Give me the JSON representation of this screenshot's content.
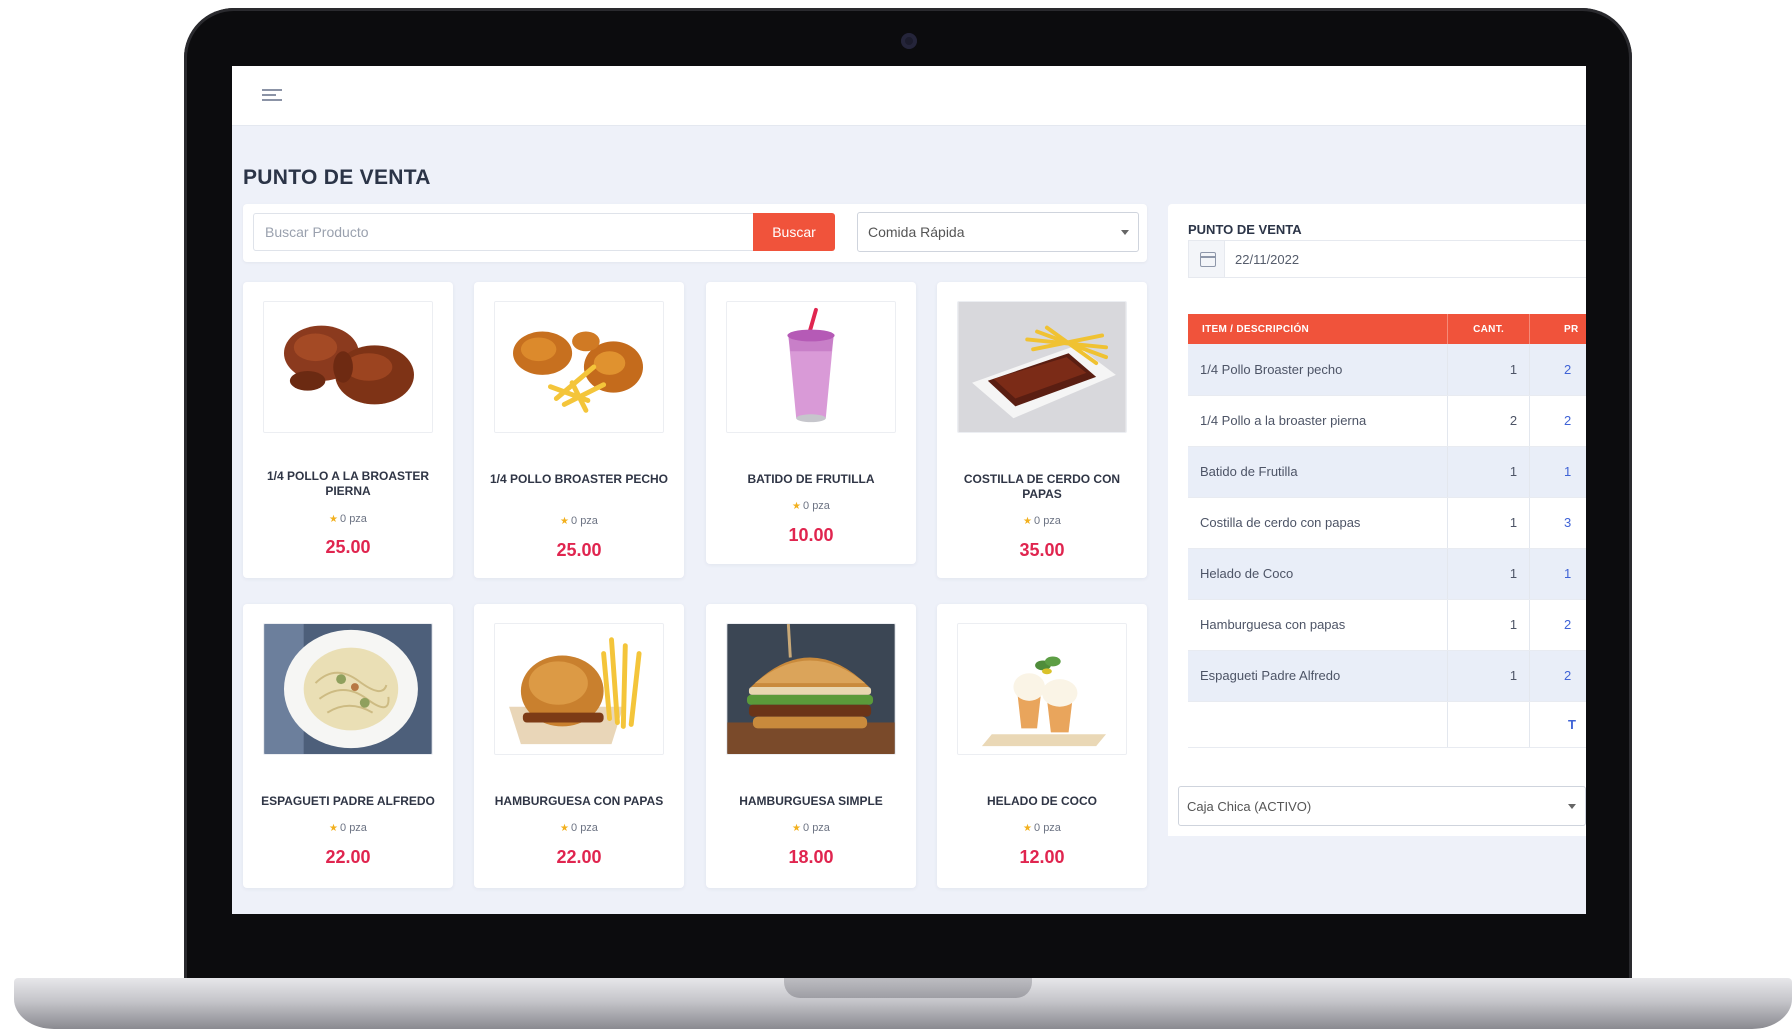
{
  "header": {
    "menu_icon": "hamburger-icon"
  },
  "page": {
    "title": "PUNTO DE VENTA"
  },
  "search": {
    "placeholder": "Buscar Producto",
    "button_label": "Buscar",
    "category_selected": "Comida Rápida"
  },
  "products": [
    {
      "name": "1/4 POLLO A LA BROASTER PIERNA",
      "stock": "0 pza",
      "price": "25.00",
      "image": "fried-chicken-leg"
    },
    {
      "name": "1/4 POLLO BROASTER PECHO",
      "stock": "0 pza",
      "price": "25.00",
      "image": "fried-chicken-fries"
    },
    {
      "name": "BATIDO DE FRUTILLA",
      "stock": "0 pza",
      "price": "10.00",
      "image": "strawberry-shake"
    },
    {
      "name": "COSTILLA DE CERDO CON PAPAS",
      "stock": "0 pza",
      "price": "35.00",
      "image": "pork-ribs-fries"
    },
    {
      "name": "ESPAGUETI PADRE ALFREDO",
      "stock": "0 pza",
      "price": "22.00",
      "image": "spaghetti-alfredo"
    },
    {
      "name": "HAMBURGUESA CON PAPAS",
      "stock": "0 pza",
      "price": "22.00",
      "image": "burger-fries"
    },
    {
      "name": "HAMBURGUESA SIMPLE",
      "stock": "0 pza",
      "price": "18.00",
      "image": "burger"
    },
    {
      "name": "HELADO DE COCO",
      "stock": "0 pza",
      "price": "12.00",
      "image": "coconut-ice-cream"
    }
  ],
  "sale": {
    "heading": "PUNTO DE VENTA",
    "date": "22/11/2022",
    "columns": {
      "description": "ITEM / DESCRIPCIÓN",
      "quantity": "CANT.",
      "price": "PR"
    },
    "items": [
      {
        "description": "1/4 Pollo Broaster pecho",
        "quantity": "1",
        "price": "2"
      },
      {
        "description": "1/4 Pollo a la broaster pierna",
        "quantity": "2",
        "price": "2"
      },
      {
        "description": "Batido de Frutilla",
        "quantity": "1",
        "price": "1"
      },
      {
        "description": "Costilla de cerdo con papas",
        "quantity": "1",
        "price": "3"
      },
      {
        "description": "Helado de Coco",
        "quantity": "1",
        "price": "1"
      },
      {
        "description": "Hamburguesa con papas",
        "quantity": "1",
        "price": "2"
      },
      {
        "description": "Espagueti Padre Alfredo",
        "quantity": "1",
        "price": "2"
      }
    ],
    "total_mark": "T",
    "cashbox_selected": "Caja Chica (ACTIVO)"
  },
  "colors": {
    "accent": "#f0533b",
    "price": "#e0254f",
    "link": "#3f63d6"
  }
}
